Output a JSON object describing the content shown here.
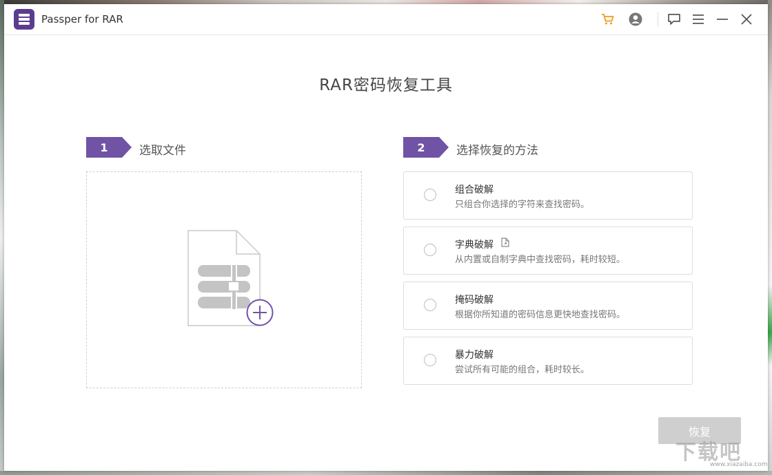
{
  "window": {
    "title": "Passper for RAR"
  },
  "titlebar": {
    "icons": [
      "cart-icon",
      "user-icon",
      "feedback-icon",
      "menu-icon",
      "minimize-icon",
      "close-icon"
    ],
    "cart_color": "#f29a1b"
  },
  "main": {
    "heading": "RAR密码恢复工具"
  },
  "step1": {
    "number": "1",
    "label": "选取文件"
  },
  "step2": {
    "number": "2",
    "label": "选择恢复的方法"
  },
  "methods": [
    {
      "title": "组合破解",
      "desc": "只组合你选择的字符来查找密码。"
    },
    {
      "title": "字典破解",
      "desc": "从内置或自制字典中查找密码，耗时较短。",
      "icon": "document-icon"
    },
    {
      "title": "掩码破解",
      "desc": "根据你所知道的密码信息更快地查找密码。"
    },
    {
      "title": "暴力破解",
      "desc": "尝试所有可能的组合，耗时较长。"
    }
  ],
  "recover_button": "恢复",
  "watermark": {
    "text": "下载吧",
    "url": "www.xiazaiba.com"
  },
  "colors": {
    "accent": "#7153a5",
    "button_disabled": "#cfcfcf"
  }
}
